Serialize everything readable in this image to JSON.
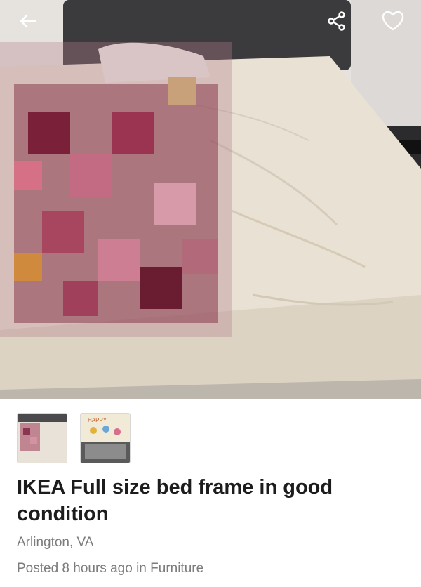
{
  "listing": {
    "title": "IKEA Full size bed frame in good condition",
    "location": "Arlington, VA",
    "posted_prefix": "Posted 8 hours ago in ",
    "category": "Furniture"
  },
  "thumbnails": [
    {
      "name": "bed-photo"
    },
    {
      "name": "bed-frame-photo",
      "caption": "HAPPY"
    }
  ],
  "icons": {
    "back": "back-arrow-icon",
    "share": "share-icon",
    "favorite": "heart-icon"
  },
  "colors": {
    "title": "#1c1c1c",
    "meta": "#7c7c7c",
    "sheet": "#ebe3d6",
    "headboard": "#3a3a3c"
  }
}
